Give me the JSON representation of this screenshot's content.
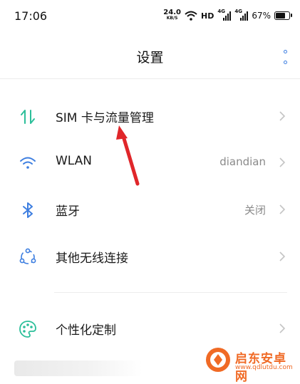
{
  "status_bar": {
    "time": "17:06",
    "speed_value": "24.0",
    "speed_unit": "KB/S",
    "hd_label": "HD",
    "signal_label": "4G",
    "battery_text": "67%"
  },
  "header": {
    "title": "设置",
    "more_icon": "more-vertical-icon"
  },
  "settings": {
    "items": [
      {
        "label": "SIM 卡与流量管理",
        "value": "",
        "icon": "sim-data-icon",
        "icon_color": "#2cbf9a"
      },
      {
        "label": "WLAN",
        "value": "diandian",
        "icon": "wifi-icon",
        "icon_color": "#3d7ee0"
      },
      {
        "label": "蓝牙",
        "value": "关闭",
        "icon": "bluetooth-icon",
        "icon_color": "#3d7ee0"
      },
      {
        "label": "其他无线连接",
        "value": "",
        "icon": "wireless-connections-icon",
        "icon_color": "#3d7ee0"
      },
      {
        "label": "个性化定制",
        "value": "",
        "icon": "palette-icon",
        "icon_color": "#2cbf9a"
      }
    ]
  },
  "annotation": {
    "arrow_color": "#e0262a"
  },
  "watermark": {
    "name": "启东安卓网",
    "url": "www.qdlutdu.com",
    "color": "#f06a25"
  }
}
